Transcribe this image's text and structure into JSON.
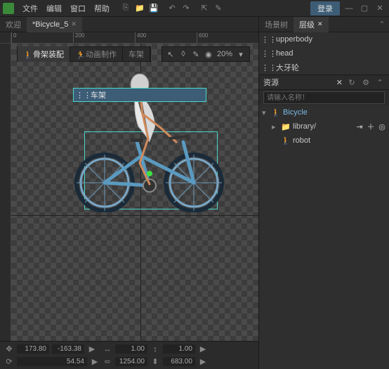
{
  "menu": {
    "file": "文件",
    "edit": "编辑",
    "window": "窗口",
    "help": "帮助",
    "login": "登录"
  },
  "doc_tabs": {
    "welcome": "欢迎",
    "current": "*Bicycle_5"
  },
  "ruler_marks": [
    "0",
    "200",
    "400",
    "600"
  ],
  "modes": {
    "rig": "骨架装配",
    "anim": "动画制作",
    "frame": "车架"
  },
  "zoom": "20%",
  "status": {
    "tx": "173.80",
    "ty": "-163.38",
    "rot": "54.54",
    "sx": "1.00",
    "sy": "1.00",
    "w": "1254.00",
    "h": "683.00"
  },
  "right_tabs": {
    "scene_tree": "场景树",
    "hierarchy": "层级"
  },
  "hierarchy": [
    "upperbody",
    "head",
    "大牙轮",
    "车架"
  ],
  "assets_title": "资源",
  "search_placeholder": "请输入名称！",
  "assets": {
    "root": "Bicycle",
    "folder": "library/",
    "robot": "robot"
  }
}
